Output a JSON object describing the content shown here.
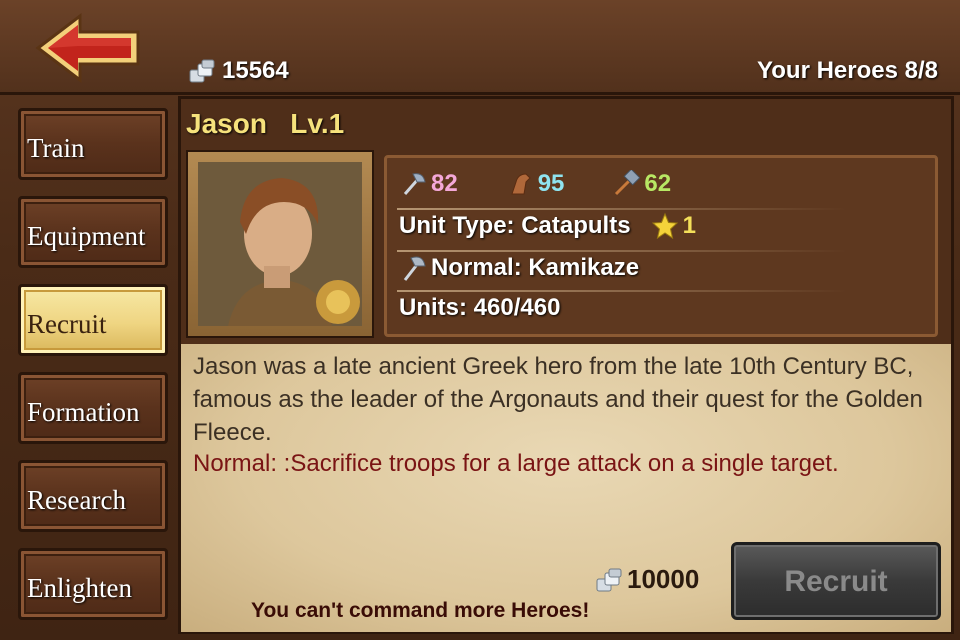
{
  "header": {
    "silver": "15564",
    "heroes_count": "Your Heroes 8/8"
  },
  "sidebar": {
    "items": [
      {
        "label": "Train"
      },
      {
        "label": "Equipment"
      },
      {
        "label": "Recruit"
      },
      {
        "label": "Formation"
      },
      {
        "label": "Research"
      },
      {
        "label": "Enlighten"
      }
    ],
    "active": "Recruit"
  },
  "hero": {
    "name": "Jason",
    "level": "Lv.1",
    "attack": "82",
    "speed": "95",
    "siege": "62",
    "unit_type": "Unit Type: Catapults",
    "stars": "1",
    "skill": "Normal: Kamikaze",
    "units": "Units: 460/460",
    "description": "Jason was a late ancient Greek hero from the late 10th Century BC, famous as the leader of the Argonauts and their quest for the Golden Fleece.",
    "skill_description": "Normal: :Sacrifice troops for a large attack on a single target."
  },
  "recruit": {
    "cost": "10000",
    "button_label": "Recruit",
    "warning": "You can't command more Heroes!"
  },
  "colors": {
    "name_yellow": "#f6e27c",
    "attack_pink": "#f4a8d8",
    "speed_cyan": "#8fe4f0",
    "siege_green": "#b8e864",
    "skill_desc_red": "#7a1414"
  },
  "icons": {
    "back": "back-arrow-icon",
    "silver": "silver-coins-icon",
    "attack": "axe-icon",
    "speed": "horse-icon",
    "siege": "siege-hammer-icon",
    "star": "star-icon",
    "skill": "skill-axe-icon"
  }
}
